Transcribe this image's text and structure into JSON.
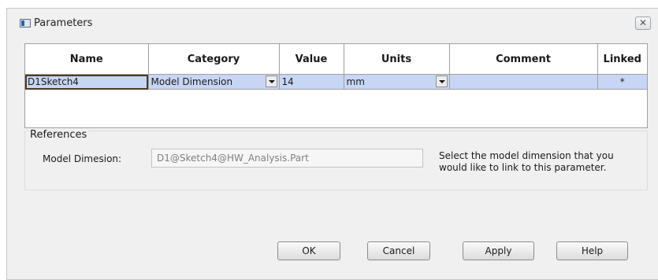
{
  "window": {
    "title": "Parameters",
    "close_glyph": "✕"
  },
  "grid": {
    "columns": [
      "Name",
      "Category",
      "Value",
      "Units",
      "Comment",
      "Linked"
    ],
    "rows": [
      {
        "name": "D1Sketch4",
        "category": "Model Dimension",
        "value": "14",
        "units": "mm",
        "comment": "",
        "linked": "*"
      }
    ]
  },
  "references": {
    "legend": "References",
    "label": "Model Dimesion:",
    "value": "D1@Sketch4@HW_Analysis.Part",
    "help_text": "Select the model dimension that you would like to link to this parameter."
  },
  "buttons": {
    "ok": "OK",
    "cancel": "Cancel",
    "apply": "Apply",
    "help": "Help"
  },
  "colors": {
    "selected_row": "#c8d6f5",
    "dialog_bg": "#f0f0f0"
  },
  "icons": {
    "title": "window-icon",
    "close": "close-icon",
    "dropdown": "chevron-down-icon"
  }
}
